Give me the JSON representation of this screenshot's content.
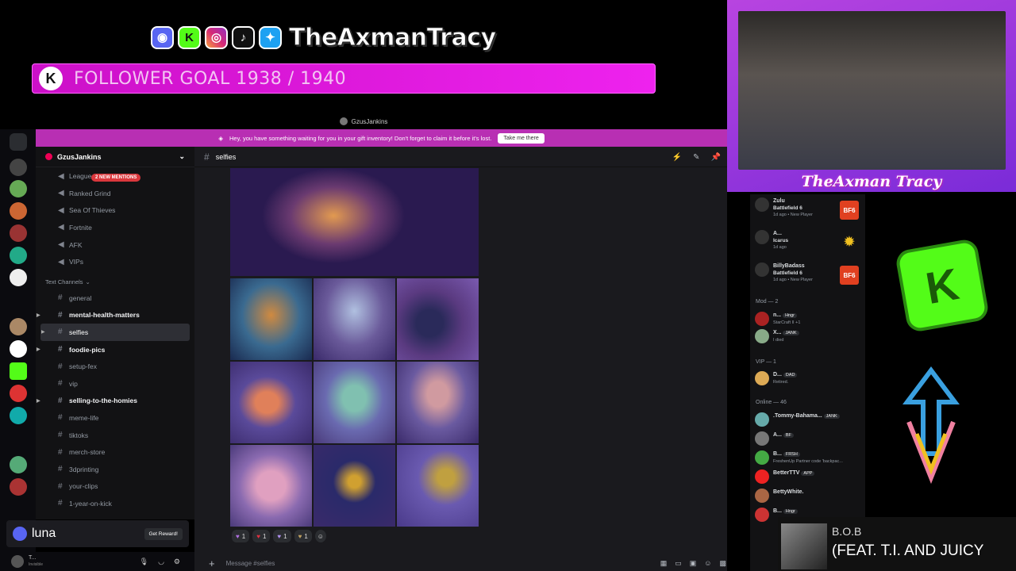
{
  "overlay": {
    "brand_name": "TheAxmanTracy",
    "social_icons": [
      "discord-icon",
      "kick-icon",
      "instagram-icon",
      "tiktok-icon",
      "twitter-icon"
    ],
    "follower_goal": "FOLLOWER GOAL 1938 / 1940",
    "webcam_name": "TheAxman Tracy"
  },
  "titlebar": {
    "user": "GzusJankins"
  },
  "banner": {
    "text": "Hey, you have something waiting for you in your gift inventory! Don't forget to claim it before it's lost.",
    "button": "Take me there"
  },
  "sidebar": {
    "server_name": "GzusJankins",
    "mentions_badge": "2 NEW MENTIONS",
    "voice_channels": [
      "League Of...",
      "Ranked Grind",
      "Sea Of Thieves",
      "Fortnite",
      "AFK",
      "VIPs"
    ],
    "section_label": "Text Channels",
    "text_channels": [
      "general",
      "mental-health-matters",
      "selfies",
      "foodie-pics",
      "setup-fex",
      "vip",
      "selling-to-the-homies",
      "meme-life",
      "tiktoks",
      "merch-store",
      "3dprinting",
      "your-clips",
      "1-year-on-kick"
    ],
    "luna_label": "luna",
    "get_reward": "Get Reward!",
    "user_status": "Invisible",
    "user_initial": "T..."
  },
  "channel": {
    "name": "selfies",
    "composer_placeholder": "Message #selfies"
  },
  "reactions": [
    {
      "icon": "purple-heart",
      "count": "1"
    },
    {
      "icon": "red-heart",
      "count": "1"
    },
    {
      "icon": "lavender-heart",
      "count": "1"
    },
    {
      "icon": "sticker",
      "count": "1"
    }
  ],
  "members": {
    "top": [
      {
        "name": "Zulu",
        "game": "Battlefield 6",
        "sub": "1d ago • New Player"
      },
      {
        "name": "A...",
        "game": "Icarus",
        "sub": "1d ago"
      },
      {
        "name": "BillyBadass",
        "game": "Battlefield 6",
        "sub": "1d ago • New Player"
      }
    ],
    "mod_header": "Mod — 2",
    "mods": [
      {
        "name": "n...",
        "badge": "Hngr",
        "sub": "StarCraft II +1"
      },
      {
        "name": "X...",
        "badge": "JANK",
        "sub": "I died"
      }
    ],
    "vip_header": "VIP — 1",
    "vips": [
      {
        "name": "D...",
        "badge": "DAD",
        "sub": "Retired."
      }
    ],
    "online_header": "Online — 46",
    "online": [
      {
        "name": ".Tommy-Bahama...",
        "badge": "JANK",
        "sub": ""
      },
      {
        "name": "A...",
        "badge": "BF",
        "sub": ""
      },
      {
        "name": "B...",
        "badge": "FRSH",
        "sub": "FreshenUp Partner code 'backpac..."
      },
      {
        "name": "BetterTTV",
        "badge": "APP",
        "sub": ""
      },
      {
        "name": "BettyWhite.",
        "badge": "",
        "sub": ""
      },
      {
        "name": "B...",
        "badge": "Hngr",
        "sub": ""
      }
    ]
  },
  "music": {
    "title": "B.O.B",
    "subtitle": "(FEAT. T.I. AND JUICY"
  },
  "colors": {
    "banner": "#b82fb3",
    "goal_bar": "#e01ee0",
    "discord_bg": "#1a1a1e",
    "kick_green": "#53fc18"
  }
}
